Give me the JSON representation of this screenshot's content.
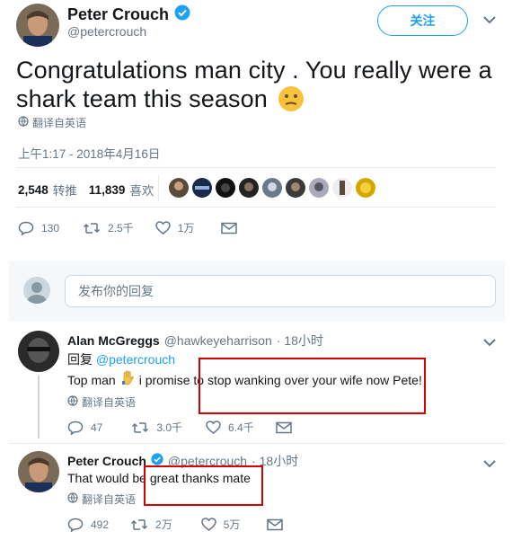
{
  "main_tweet": {
    "author_name": "Peter Crouch",
    "author_handle": "@petercrouch",
    "follow_label": "关注",
    "text": "Congratulations man city . You really were a shark team this season",
    "emoji": "😕",
    "translate_label": "翻译自英语",
    "timestamp": "上午1:17 - 2018年4月16日",
    "retweets_count": "2,548",
    "retweets_label": "转推",
    "likes_count": "11,839",
    "likes_label": "喜欢",
    "actions": {
      "reply_count": "130",
      "retweet_count": "2.5千",
      "like_count": "1万"
    }
  },
  "reply_box": {
    "placeholder": "发布你的回复"
  },
  "replies": [
    {
      "author_name": "Alan McGreggs",
      "author_handle": "@hawkeyeharrison",
      "time": "· 18小时",
      "replying_prefix": "回复",
      "replying_to": "@petercrouch",
      "text_start": "Top man",
      "text_end": "i promise to stop wanking over your wife now Pete!",
      "translate_label": "翻译自英语",
      "reply_count": "47",
      "retweet_count": "3.0千",
      "like_count": "6.4千"
    },
    {
      "author_name": "Peter Crouch",
      "author_handle": "@petercrouch",
      "time": "· 18小时",
      "text": "That would be great thanks mate",
      "translate_label": "翻译自英语",
      "reply_count": "492",
      "retweet_count": "2万",
      "like_count": "5万"
    }
  ],
  "colors": {
    "accent": "#1da1f2",
    "muted": "#657786",
    "highlight_box": "#d40000"
  }
}
